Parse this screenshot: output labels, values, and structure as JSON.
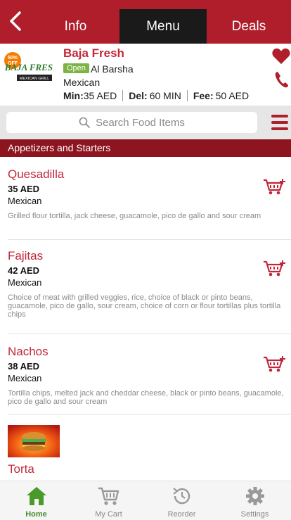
{
  "nav": {
    "tabs": [
      {
        "label": "Info"
      },
      {
        "label": "Menu"
      },
      {
        "label": "Deals"
      }
    ],
    "active_tab": "Menu"
  },
  "restaurant": {
    "name": "Baja Fresh",
    "logo_badge": "50% OFF",
    "logo_text": "BAJA FRESH",
    "logo_subtext": "MEXICAN GRILL",
    "status": "Open",
    "area": "Al Barsha",
    "cuisine": "Mexican",
    "min_label": "Min:",
    "min_value": "35 AED",
    "del_label": "Del:",
    "del_value": "60 MIN",
    "fee_label": "Fee:",
    "fee_value": "50 AED"
  },
  "search": {
    "placeholder": "Search Food Items"
  },
  "category": {
    "title": "Appetizers and Starters"
  },
  "items": [
    {
      "name": "Quesadilla",
      "price": "35 AED",
      "cuisine": "Mexican",
      "description": "Grilled flour tortilla, jack cheese, guacamole, pico de gallo and sour cream"
    },
    {
      "name": "Fajitas",
      "price": "42 AED",
      "cuisine": "Mexican",
      "description": "Choice of meat with grilled veggies, rice, choice of black or pinto beans, guacamole, pico de gallo, sour cream, choice of corn or flour tortillas plus tortilla chips"
    },
    {
      "name": "Nachos",
      "price": "38 AED",
      "cuisine": "Mexican",
      "description": "Tortilla chips, melted jack and cheddar cheese, black or pinto beans, guacamole, pico de gallo and sour cream"
    },
    {
      "name": "Torta"
    }
  ],
  "bottom_nav": {
    "items": [
      {
        "label": "Home",
        "icon": "home-icon"
      },
      {
        "label": "My Cart",
        "icon": "cart-icon"
      },
      {
        "label": "Reorder",
        "icon": "reorder-icon"
      },
      {
        "label": "Settings",
        "icon": "gear-icon"
      }
    ]
  },
  "colors": {
    "brand_red": "#b01e2b",
    "active_tab_bg": "#1a1a1a",
    "category_bg": "#8c1520",
    "open_badge": "#7cb342",
    "home_active": "#4a8a2a"
  }
}
